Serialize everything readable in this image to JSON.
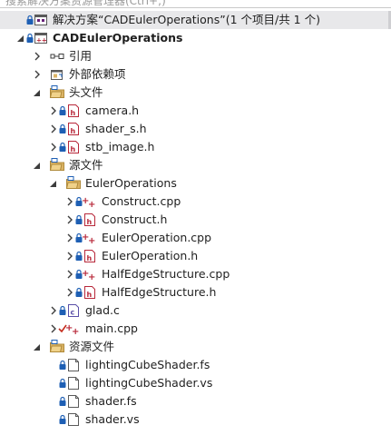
{
  "search": {
    "placeholder": "搜索解决方案资源管理器(Ctrl+;)"
  },
  "tree": [
    {
      "label": "解决方案“CADEulerOperations”(1 个项目/共 1 个)",
      "icon": "solution-icon",
      "twisty": "none",
      "lock": true,
      "depth": 0,
      "selected": true,
      "bold": false
    },
    {
      "label": "CADEulerOperations",
      "icon": "cpp-project-icon",
      "twisty": "expanded",
      "lock": true,
      "depth": 0,
      "selected": false,
      "bold": true
    },
    {
      "label": "引用",
      "icon": "references-icon",
      "twisty": "collapsed",
      "lock": false,
      "depth": 1,
      "selected": false,
      "bold": false
    },
    {
      "label": "外部依赖项",
      "icon": "external-deps-icon",
      "twisty": "collapsed",
      "lock": false,
      "depth": 1,
      "selected": false,
      "bold": false
    },
    {
      "label": "头文件",
      "icon": "folder-filter-icon",
      "twisty": "expanded",
      "lock": false,
      "depth": 1,
      "selected": false,
      "bold": false
    },
    {
      "label": "camera.h",
      "icon": "header-file-icon",
      "twisty": "collapsed",
      "lock": true,
      "depth": 2,
      "selected": false,
      "bold": false
    },
    {
      "label": "shader_s.h",
      "icon": "header-file-icon",
      "twisty": "collapsed",
      "lock": true,
      "depth": 2,
      "selected": false,
      "bold": false
    },
    {
      "label": "stb_image.h",
      "icon": "header-file-icon",
      "twisty": "collapsed",
      "lock": true,
      "depth": 2,
      "selected": false,
      "bold": false
    },
    {
      "label": "源文件",
      "icon": "folder-filter-icon",
      "twisty": "expanded",
      "lock": false,
      "depth": 1,
      "selected": false,
      "bold": false
    },
    {
      "label": "EulerOperations",
      "icon": "folder-filter-icon",
      "twisty": "expanded",
      "lock": false,
      "depth": 2,
      "selected": false,
      "bold": false
    },
    {
      "label": "Construct.cpp",
      "icon": "cpp-file-icon",
      "twisty": "collapsed",
      "lock": true,
      "depth": 3,
      "selected": false,
      "bold": false
    },
    {
      "label": "Construct.h",
      "icon": "header-file-icon",
      "twisty": "collapsed",
      "lock": true,
      "depth": 3,
      "selected": false,
      "bold": false
    },
    {
      "label": "EulerOperation.cpp",
      "icon": "cpp-file-icon",
      "twisty": "collapsed",
      "lock": true,
      "depth": 3,
      "selected": false,
      "bold": false
    },
    {
      "label": "EulerOperation.h",
      "icon": "header-file-icon",
      "twisty": "collapsed",
      "lock": true,
      "depth": 3,
      "selected": false,
      "bold": false
    },
    {
      "label": "HalfEdgeStructure.cpp",
      "icon": "cpp-file-icon",
      "twisty": "collapsed",
      "lock": true,
      "depth": 3,
      "selected": false,
      "bold": false
    },
    {
      "label": "HalfEdgeStructure.h",
      "icon": "header-file-icon",
      "twisty": "collapsed",
      "lock": true,
      "depth": 3,
      "selected": false,
      "bold": false
    },
    {
      "label": "glad.c",
      "icon": "c-file-icon",
      "twisty": "collapsed",
      "lock": true,
      "depth": 2,
      "selected": false,
      "bold": false
    },
    {
      "label": "main.cpp",
      "icon": "cpp-file-icon",
      "twisty": "collapsed",
      "lock": false,
      "checkmark": true,
      "depth": 2,
      "selected": false,
      "bold": false
    },
    {
      "label": "资源文件",
      "icon": "folder-filter-icon",
      "twisty": "expanded",
      "lock": false,
      "depth": 1,
      "selected": false,
      "bold": false
    },
    {
      "label": "lightingCubeShader.fs",
      "icon": "text-file-icon",
      "twisty": "none",
      "lock": true,
      "depth": 2,
      "selected": false,
      "bold": false
    },
    {
      "label": "lightingCubeShader.vs",
      "icon": "text-file-icon",
      "twisty": "none",
      "lock": true,
      "depth": 2,
      "selected": false,
      "bold": false
    },
    {
      "label": "shader.fs",
      "icon": "text-file-icon",
      "twisty": "none",
      "lock": true,
      "depth": 2,
      "selected": false,
      "bold": false
    },
    {
      "label": "shader.vs",
      "icon": "text-file-icon",
      "twisty": "none",
      "lock": true,
      "depth": 2,
      "selected": false,
      "bold": false
    }
  ],
  "colors": {
    "selection": "#e8e8ea",
    "lock": "#1e5fb4",
    "header_red": "#b8283a",
    "cpp_red": "#b8283a",
    "folder_yellow": "#dcb567",
    "checkmark_red": "#c42b1c"
  }
}
